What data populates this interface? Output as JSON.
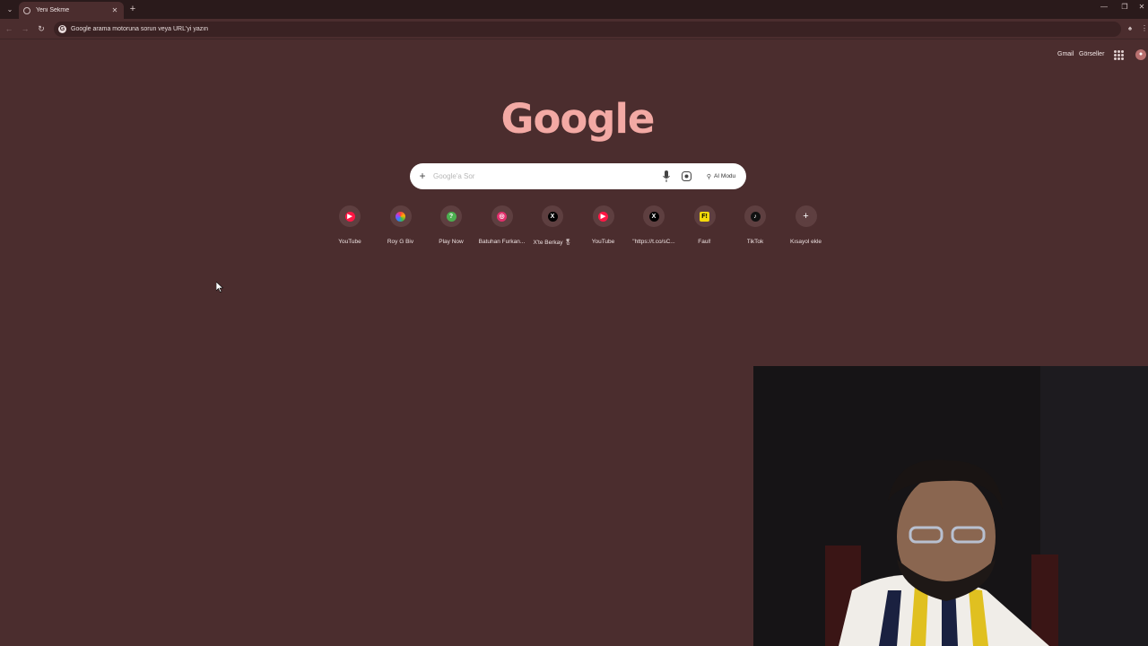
{
  "tab": {
    "title": "Yeni Sekme",
    "close": "✕",
    "new": "+"
  },
  "window": {
    "minimize": "—",
    "maximize": "❐",
    "close": "✕"
  },
  "omnibox": {
    "placeholder": "Google arama motoruna sorun veya URL'yi yazın",
    "g_icon": "G"
  },
  "toplinks": {
    "gmail": "Gmail",
    "images": "Görseller"
  },
  "logo": "Google",
  "search": {
    "placeholder": "Google'a Sor",
    "ai_mode": "AI Modu"
  },
  "shortcuts": [
    {
      "label": "YouTube",
      "icon": "youtube-icon",
      "color": "#ff1744",
      "glyph": "▶"
    },
    {
      "label": "Roy G Biv",
      "icon": "roy-g-biv-icon",
      "color": "#7a5cff",
      "glyph": ""
    },
    {
      "label": "Play Now",
      "icon": "play-now-icon",
      "color": "#4caf50",
      "glyph": "?"
    },
    {
      "label": "Batuhan Furkan...",
      "icon": "instagram-icon",
      "color": "#e1306c",
      "glyph": "◎"
    },
    {
      "label": "X'te Berkay 🎖",
      "icon": "x-icon",
      "color": "#000000",
      "glyph": "X"
    },
    {
      "label": "YouTube",
      "icon": "youtube-icon",
      "color": "#ff1744",
      "glyph": "▶"
    },
    {
      "label": "\"https://t.co/sC...",
      "icon": "x-icon",
      "color": "#000000",
      "glyph": "X"
    },
    {
      "label": "Faul!",
      "icon": "faul-icon",
      "color": "#f5d90a",
      "glyph": "F!"
    },
    {
      "label": "TikTok",
      "icon": "tiktok-icon",
      "color": "#111111",
      "glyph": "♪"
    },
    {
      "label": "Kısayol ekle",
      "icon": "add-shortcut-icon",
      "color": "#5e3f40",
      "glyph": "+"
    }
  ],
  "colors": {
    "background": "#4b2d2e",
    "tabstrip": "#2a1a1b",
    "logo": "#f3a9a4"
  }
}
